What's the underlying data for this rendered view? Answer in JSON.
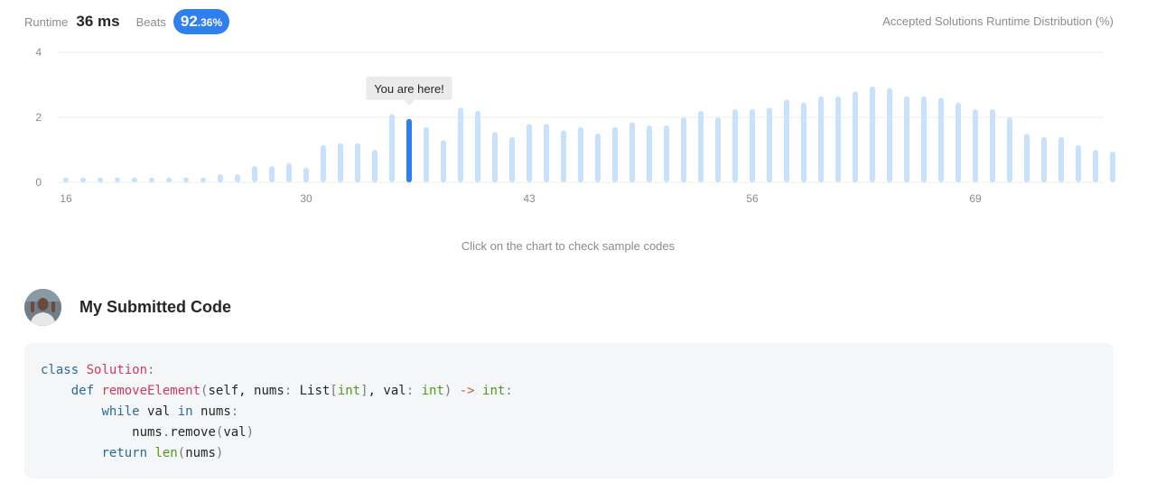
{
  "stats": {
    "runtime_label": "Runtime",
    "runtime_value": "36 ms",
    "beats_label": "Beats",
    "beats_int": "92",
    "beats_dec": ".36%"
  },
  "distribution_title": "Accepted Solutions Runtime Distribution (%)",
  "tooltip": "You are here!",
  "hint": "Click on the chart to check sample codes",
  "colors": {
    "accent": "#2f80ed",
    "bar": "#c9e2fb",
    "highlight": "#2f80ed",
    "grid": "#eeeeee"
  },
  "chart_data": {
    "type": "bar",
    "ylim": [
      0,
      4
    ],
    "yticks": [
      0,
      2,
      4
    ],
    "xticks": [
      16,
      30,
      43,
      56,
      69
    ],
    "highlight_x": 36,
    "x": [
      16,
      17,
      18,
      19,
      20,
      21,
      22,
      23,
      24,
      25,
      26,
      27,
      28,
      29,
      30,
      31,
      32,
      33,
      34,
      35,
      36,
      37,
      38,
      39,
      40,
      41,
      42,
      43,
      44,
      45,
      46,
      47,
      48,
      49,
      50,
      51,
      52,
      53,
      54,
      55,
      56,
      57,
      58,
      59,
      60,
      61,
      62,
      63,
      64,
      65,
      66,
      67,
      68,
      69,
      70,
      71,
      72,
      73,
      74,
      75,
      76,
      77
    ],
    "values": [
      0.15,
      0.15,
      0.15,
      0.15,
      0.15,
      0.15,
      0.15,
      0.15,
      0.15,
      0.25,
      0.25,
      0.5,
      0.5,
      0.6,
      0.45,
      1.15,
      1.2,
      1.2,
      1.0,
      2.1,
      1.95,
      1.7,
      1.3,
      2.3,
      2.2,
      1.55,
      1.4,
      1.8,
      1.8,
      1.6,
      1.7,
      1.5,
      1.7,
      1.85,
      1.75,
      1.75,
      2.0,
      2.2,
      2.0,
      2.25,
      2.25,
      2.3,
      2.55,
      2.45,
      2.65,
      2.65,
      2.8,
      2.95,
      2.9,
      2.65,
      2.65,
      2.6,
      2.45,
      2.25,
      2.25,
      2.0,
      1.5,
      1.4,
      1.4,
      1.15,
      1.0,
      0.95
    ]
  },
  "code_section": {
    "title": "My Submitted Code",
    "avatar_icon": "user-avatar-photo"
  }
}
